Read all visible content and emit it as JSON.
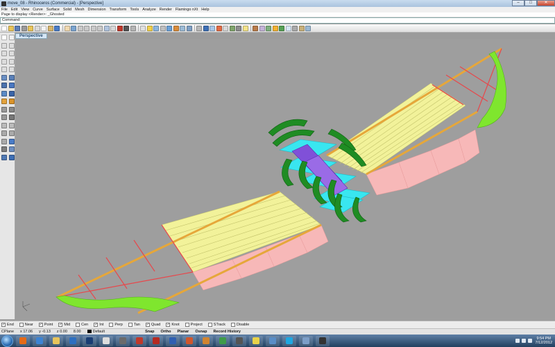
{
  "window": {
    "title": "move_08 - Rhinoceros (Commercial) - [Perspective]",
    "buttons": {
      "minimize": "–",
      "maximize": "□",
      "close": "✕"
    }
  },
  "menubar": [
    "File",
    "Edit",
    "View",
    "Curve",
    "Surface",
    "Solid",
    "Mesh",
    "Dimension",
    "Transform",
    "Tools",
    "Analyze",
    "Render",
    "Flamingo nXt",
    "Help"
  ],
  "command_history": "Page to display <Render>: _Ghosted",
  "command_prompt": {
    "label": "Command:",
    "value": ""
  },
  "toolbar": {
    "icons": [
      {
        "name": "new-icon",
        "color": "#ffffff"
      },
      {
        "name": "open-icon",
        "color": "#e8c55a"
      },
      {
        "name": "save-icon",
        "color": "#5d7fb8"
      },
      {
        "name": "print-icon",
        "color": "#9a9a9a"
      },
      {
        "name": "import-icon",
        "color": "#e8c55a"
      },
      {
        "name": "cut-icon",
        "color": "#d9d9d9"
      },
      {
        "name": "copy-icon",
        "color": "#f4f4f4"
      },
      {
        "name": "paste-icon",
        "color": "#d7b56b"
      },
      {
        "name": "undo-icon",
        "color": "#4a7cc7"
      },
      {
        "name": "pan-icon",
        "color": "#f0d9b0"
      },
      {
        "name": "rotate-view-icon",
        "color": "#7aa4d0"
      },
      {
        "name": "zoom-icon",
        "color": "#c9c9c9"
      },
      {
        "name": "zoom-window-icon",
        "color": "#c9c9c9"
      },
      {
        "name": "zoom-extents-icon",
        "color": "#c9c9c9"
      },
      {
        "name": "zoom-selected-icon",
        "color": "#c9c9c9"
      },
      {
        "name": "undo-view-icon",
        "color": "#b0c4de"
      },
      {
        "name": "four-viewports-icon",
        "color": "#d8d8d8"
      },
      {
        "name": "car-icon",
        "color": "#c0392b"
      },
      {
        "name": "points-icon",
        "color": "#555555"
      },
      {
        "name": "grid-icon",
        "color": "#b5b5b5"
      },
      {
        "name": "select-icon",
        "color": "#e0e0e0"
      },
      {
        "name": "lightbulb-icon",
        "color": "#f1d04b"
      },
      {
        "name": "layers-icon",
        "color": "#8bb6e0"
      },
      {
        "name": "properties-icon",
        "color": "#c0c0c0"
      },
      {
        "name": "render-sphere-icon",
        "color": "#6aa0d8"
      },
      {
        "name": "material-icon",
        "color": "#d98c3a"
      },
      {
        "name": "shaded-icon",
        "color": "#9bbbd6"
      },
      {
        "name": "rendered-icon",
        "color": "#7e9fc4"
      },
      {
        "name": "options-icon",
        "color": "#b8b8b8"
      },
      {
        "name": "help-icon",
        "color": "#3c6fb5"
      },
      {
        "name": "surface-icon",
        "color": "#a9c7e8"
      },
      {
        "name": "flamingo-icon",
        "color": "#e36b44"
      },
      {
        "name": "render-icon",
        "color": "#d8d8d8"
      },
      {
        "name": "environment-icon",
        "color": "#7fa56b"
      },
      {
        "name": "camera-icon",
        "color": "#8c8c8c"
      },
      {
        "name": "light-icon",
        "color": "#f3e38a"
      },
      {
        "name": "texture-icon",
        "color": "#b97c4a"
      },
      {
        "name": "decal-icon",
        "color": "#c4b3d9"
      },
      {
        "name": "ground-plane-icon",
        "color": "#7fb07f"
      },
      {
        "name": "sun-icon",
        "color": "#f2b233"
      },
      {
        "name": "plant-icon",
        "color": "#56a156"
      },
      {
        "name": "cloud-icon",
        "color": "#d6e6f5"
      },
      {
        "name": "settings-icon",
        "color": "#aaaaaa"
      },
      {
        "name": "library-icon",
        "color": "#c8b07a"
      },
      {
        "name": "batch-render-icon",
        "color": "#9ab8d3"
      }
    ]
  },
  "left_tools": [
    {
      "name": "select-arrow-icon",
      "color": "#ffffff"
    },
    {
      "name": "point-icon",
      "color": "#f0f0f0"
    },
    {
      "name": "polyline-icon",
      "color": "#dddddd"
    },
    {
      "name": "curve-icon",
      "color": "#dddddd"
    },
    {
      "name": "circle-icon",
      "color": "#dddddd"
    },
    {
      "name": "arc-icon",
      "color": "#dddddd"
    },
    {
      "name": "ellipse-icon",
      "color": "#dddddd"
    },
    {
      "name": "rectangle-icon",
      "color": "#dddddd"
    },
    {
      "name": "polygon-icon",
      "color": "#dddddd"
    },
    {
      "name": "freeform-icon",
      "color": "#dddddd"
    },
    {
      "name": "surface-corner-icon",
      "color": "#6a8fc4"
    },
    {
      "name": "extrude-icon",
      "color": "#5a80b8"
    },
    {
      "name": "box-icon",
      "color": "#4b72ad"
    },
    {
      "name": "sphere-icon",
      "color": "#4a78c2"
    },
    {
      "name": "mesh-icon",
      "color": "#5b8ac6"
    },
    {
      "name": "boolean-icon",
      "color": "#3b65a8"
    },
    {
      "name": "fillet-icon",
      "color": "#e3a23b"
    },
    {
      "name": "trim-icon",
      "color": "#d9932a"
    },
    {
      "name": "split-icon",
      "color": "#999999"
    },
    {
      "name": "join-icon",
      "color": "#888888"
    },
    {
      "name": "explode-icon",
      "color": "#999999"
    },
    {
      "name": "group-icon",
      "color": "#777777"
    },
    {
      "name": "move-icon",
      "color": "#bbbbbb"
    },
    {
      "name": "copy-object-icon",
      "color": "#bbbbbb"
    },
    {
      "name": "rotate-icon",
      "color": "#aaaaaa"
    },
    {
      "name": "scale-icon",
      "color": "#aaaaaa"
    },
    {
      "name": "mirror-icon",
      "color": "#aaaaaa"
    },
    {
      "name": "array-icon",
      "color": "#4a7cc7"
    },
    {
      "name": "dimension-icon",
      "color": "#7d7d7d"
    },
    {
      "name": "text-icon",
      "color": "#6e8fc0"
    },
    {
      "name": "analyze-icon",
      "color": "#4f79b5"
    },
    {
      "name": "render-globe-icon",
      "color": "#3f6fb5"
    }
  ],
  "viewport": {
    "tab_label": "Perspective",
    "background": "#9e9e9e",
    "colors": {
      "rib_yellow": "#f2f29a",
      "spar_orange": "#e6a73a",
      "skin_pink": "#f7b8b8",
      "wingtip_green": "#7fe62e",
      "frame_green": "#1f8c23",
      "bulkhead_cyan": "#39e6f0",
      "tube_purple": "#8050d8",
      "red_edges": "#e8474b"
    }
  },
  "osnap": [
    {
      "label": "End",
      "checked": true
    },
    {
      "label": "Near",
      "checked": false
    },
    {
      "label": "Point",
      "checked": true
    },
    {
      "label": "Mid",
      "checked": true
    },
    {
      "label": "Cen",
      "checked": false
    },
    {
      "label": "Int",
      "checked": true
    },
    {
      "label": "Perp",
      "checked": false
    },
    {
      "label": "Tan",
      "checked": false
    },
    {
      "label": "Quad",
      "checked": true
    },
    {
      "label": "Knot",
      "checked": true
    },
    {
      "label": "Project",
      "checked": false
    },
    {
      "label": "STrack",
      "checked": false
    },
    {
      "label": "Disable",
      "checked": false
    }
  ],
  "statusbar": {
    "cplane": "CPlane",
    "x": "x 17.06",
    "y": "y -0.13",
    "z": "z 0.00",
    "dist": "8.00",
    "layer": "Default",
    "panes": [
      "Snap",
      "Ortho",
      "Planar",
      "Osnap",
      "Record History"
    ]
  },
  "taskbar": {
    "apps": [
      {
        "name": "firefox-icon",
        "color": "#e66a17"
      },
      {
        "name": "explorer-icon",
        "color": "#3c83d3"
      },
      {
        "name": "folder-icon",
        "color": "#e7c45c"
      },
      {
        "name": "media-player-icon",
        "color": "#2e6fc0"
      },
      {
        "name": "photoshop-icon",
        "color": "#1a3d73"
      },
      {
        "name": "unity-icon",
        "color": "#dddddd"
      },
      {
        "name": "rhino-icon",
        "color": "#6b6b6b"
      },
      {
        "name": "sketchup-icon",
        "color": "#c0392b"
      },
      {
        "name": "acrobat-icon",
        "color": "#b52a22"
      },
      {
        "name": "word-icon",
        "color": "#2f5fb1"
      },
      {
        "name": "powerpoint-icon",
        "color": "#d0562c"
      },
      {
        "name": "illustrator-icon",
        "color": "#d08430"
      },
      {
        "name": "chrome-icon",
        "color": "#3f9b49"
      },
      {
        "name": "inkscape-icon",
        "color": "#555555"
      },
      {
        "name": "sticky-notes-icon",
        "color": "#e8d24a"
      },
      {
        "name": "mail-icon",
        "color": "#5a8dc6"
      },
      {
        "name": "skype-icon",
        "color": "#1ea7e1"
      },
      {
        "name": "monitor-icon",
        "color": "#7d9ec7"
      },
      {
        "name": "camera-app-icon",
        "color": "#333333"
      }
    ],
    "time": "9:54 PM",
    "date": "7/12/2012"
  }
}
